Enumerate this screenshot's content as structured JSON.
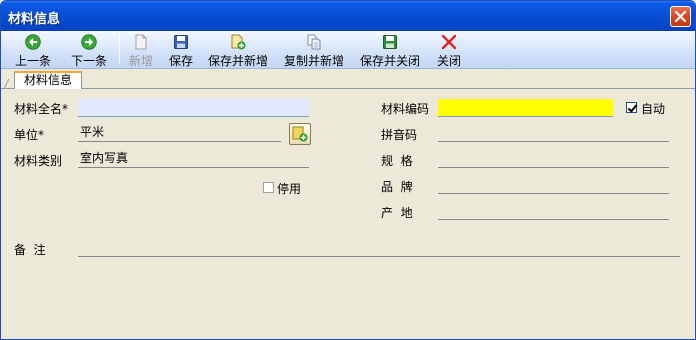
{
  "window": {
    "title": "材料信息"
  },
  "toolbar": {
    "prev": "上一条",
    "next": "下一条",
    "new": "新增",
    "save": "保存",
    "save_new": "保存并新增",
    "copy_new": "复制并新增",
    "save_close": "保存并关闭",
    "close": "关闭"
  },
  "tabs": [
    {
      "label": "材料信息",
      "active": true
    }
  ],
  "form": {
    "full_name": {
      "label": "材料全名*",
      "value": ""
    },
    "unit": {
      "label": "单位*",
      "value": "平米"
    },
    "category": {
      "label": "材料类别",
      "value": "室内写真"
    },
    "disabled": {
      "label": "停用",
      "checked": false
    },
    "code": {
      "label": "材料编码",
      "value": ""
    },
    "auto": {
      "label": "自动",
      "checked": true
    },
    "pinyin": {
      "label": "拼音码",
      "value": ""
    },
    "spec": {
      "label": "规  格",
      "value": ""
    },
    "brand": {
      "label": "品  牌",
      "value": ""
    },
    "origin": {
      "label": "产  地",
      "value": ""
    },
    "remark": {
      "label": "备  注",
      "value": ""
    }
  },
  "colors": {
    "title_bar": "#0850d8",
    "required_field_bg": "#dfe8fd",
    "code_field_bg": "#ffff00",
    "tab_accent": "#f2a93b"
  }
}
